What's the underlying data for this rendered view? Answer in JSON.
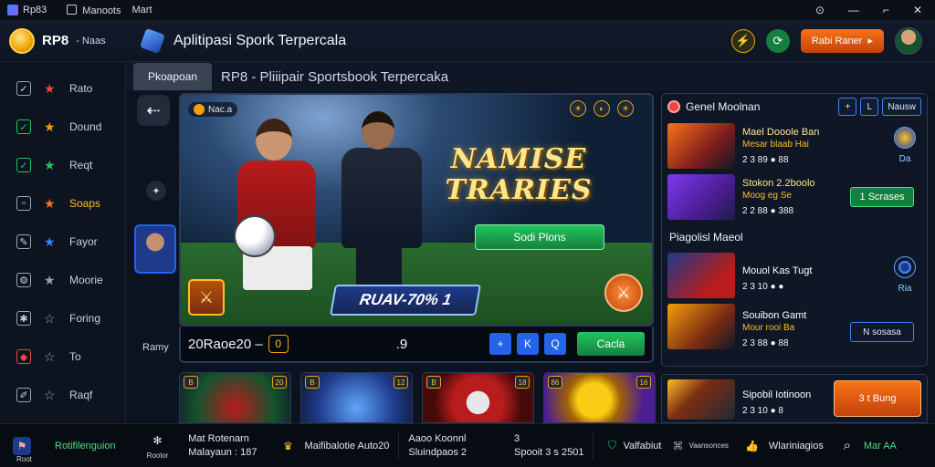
{
  "titlebar": {
    "app": "Rp83",
    "menu": [
      "Manoots",
      "Mart"
    ],
    "controls": [
      "⊙",
      "—",
      "⌐",
      "✕"
    ]
  },
  "header": {
    "brand_name": "RP8",
    "brand_sub": "- Naas",
    "title": "Aplitipasi Spork Terpercala",
    "action_label": "Rabi Raner",
    "action_arrow": "▸"
  },
  "sidebar": {
    "items": [
      {
        "label": "Rato",
        "icon": "check-icon",
        "check": "✓",
        "star_color": "#ef4444"
      },
      {
        "label": "Dound",
        "icon": "check-icon",
        "check": "✓",
        "star_color": "#f59e0b"
      },
      {
        "label": "Reqt",
        "icon": "check-icon",
        "check": "✓",
        "star_color": "#22c55e"
      },
      {
        "label": "Soaps",
        "icon": "box-icon",
        "check": "▫",
        "star_color": "#f97316"
      },
      {
        "label": "Fayor",
        "icon": "edit-icon",
        "check": "✎",
        "star_color": "#3b82f6"
      },
      {
        "label": "Moorie",
        "icon": "gear-icon",
        "check": "⚙",
        "star_color": "#9ca3af"
      },
      {
        "label": "Foring",
        "icon": "settings-icon",
        "check": "✱",
        "star_color": "#9ca3af"
      },
      {
        "label": "To",
        "icon": "shield-icon",
        "check": "◆",
        "star_color": "#9ca3af"
      },
      {
        "label": "Raqf",
        "icon": "pencil-icon",
        "check": "✐",
        "star_color": "#9ca3af"
      }
    ]
  },
  "subbar": {
    "tab": "Pkoapoan",
    "path": "RP8 - Pliiipair Sportsbook Terpercaka"
  },
  "banner": {
    "tag": "Nac.a",
    "title_line1": "NAMISE",
    "title_line2": "TRARIES",
    "cta": "Sodi Plons",
    "promo": "RUAV-70% 1",
    "orb_glyph": "⚔",
    "shield_glyph": "⚔",
    "icons": [
      "☀",
      "◐",
      "☀"
    ]
  },
  "banner_bar": {
    "score": "20Raoe20 –",
    "score_badge": "0",
    "mid": ".9",
    "buttons": [
      "+",
      "K",
      "Q"
    ],
    "green": "Cacla"
  },
  "left": {
    "back": "⇠",
    "label": "Ramy"
  },
  "tiles": [
    {
      "badge_l": "B",
      "badge_r": "20"
    },
    {
      "badge_l": "B",
      "badge_r": "12"
    },
    {
      "badge_l": "B",
      "badge_r": "18"
    },
    {
      "badge_l": "86",
      "badge_r": "16"
    }
  ],
  "rpanel": {
    "head": "Genel Moolnan",
    "head_btns": [
      "+",
      "L",
      "Nausw"
    ],
    "matches": [
      {
        "title": "Mael Dooole Ban",
        "sub": "Mesar blaab Hai",
        "odds": "2 3 89 ● 88",
        "side": "Da"
      },
      {
        "title": "Stokon 2.2boolo",
        "sub": "Moog eg Se",
        "odds": "2 2 88 ● 388",
        "side_btn": "1 Scrases"
      }
    ],
    "section": "Piagolisl Maeol",
    "matches2": [
      {
        "title": "Mouol Kas Tugt",
        "odds": "2 3 10 ● ●",
        "side": "Ria"
      },
      {
        "title": "Souibon Gamt",
        "sub": "Mour rooi Ba",
        "odds": "2 3 88 ● 88",
        "side_btn": "N sosasa"
      }
    ]
  },
  "rpanel2": {
    "title": "Sipobil Iotinoon",
    "odds": "2 3 10 ● 8",
    "button": "3 t Bung"
  },
  "footer": {
    "items": [
      {
        "label": "Root",
        "value": "Rotifilenguion"
      },
      {
        "label": "Roolor",
        "value": ""
      },
      {
        "line1": "Mat Rotenarn",
        "line2": "Malayaun : 187"
      },
      {
        "line1": "Maifibalotie Auto20"
      },
      {
        "line1": "Aaoo Koonnl",
        "line2": "Sluindpaos 2"
      },
      {
        "line1": "3",
        "line2": "Spooit 3 s 2501"
      },
      {
        "line1": "Valfabiut"
      },
      {
        "line1": "Vaansonces"
      },
      {
        "line1": "Wlariniagios"
      },
      {
        "line1": "Mar AA"
      }
    ]
  }
}
